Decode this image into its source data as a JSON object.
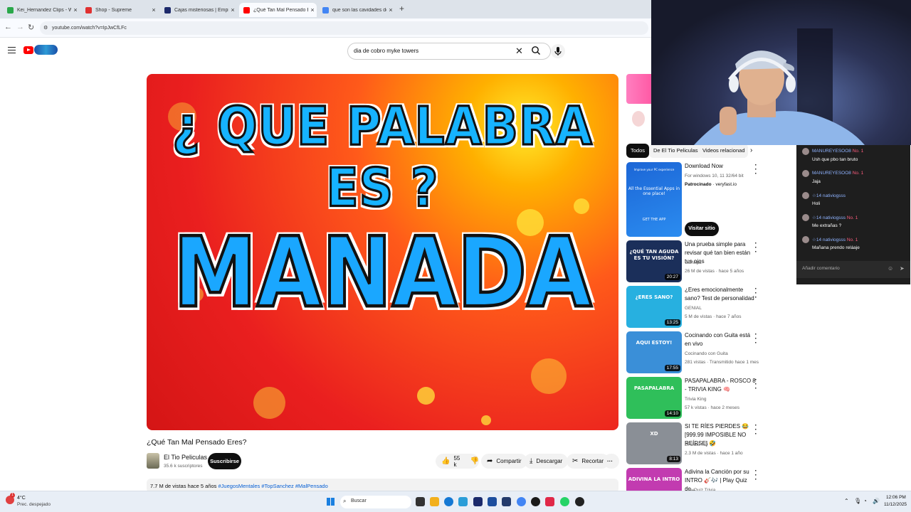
{
  "browser": {
    "tabs": [
      {
        "label": "Kei_Hernandez Clips - Watch L",
        "favicon_color": "#2aa84a",
        "active": false
      },
      {
        "label": "Shop - Supreme",
        "favicon_color": "#e03131",
        "active": false
      },
      {
        "label": "Cajas misteriosas | EmpireDrop",
        "favicon_color": "#1d2a6b",
        "active": false
      },
      {
        "label": "¿Qué Tan Mal Pensado Eres",
        "favicon_color": "#ff0000",
        "active": true
      },
      {
        "label": "que son las cavidades del cora",
        "favicon_color": "#4285f4",
        "active": false
      }
    ],
    "new_tab": "+",
    "url": "youtube.com/watch?v=IpJwCfLFc"
  },
  "youtube": {
    "search_value": "dia de cobro myke towers",
    "video": {
      "overlay_question": "¿ QUE PALABRA ES ?",
      "overlay_word": "MANADA",
      "title": "¿Qué Tan Mal Pensado Eres?",
      "channel": "El Tio Peliculas",
      "subscribers": "35.6 k suscriptores",
      "subscribe_label": "Suscribirse",
      "likes": "55 k",
      "share_label": "Compartir",
      "download_label": "Descargar",
      "clip_label": "Recortar",
      "more": "···",
      "views_date": "7.7 M de vistas  hace 5 años",
      "hashtags": "#JuegosMentales #TopSanchez #MalPensado"
    },
    "chips": [
      "Todos",
      "De El Tio Peliculas",
      "Videos relacionad"
    ],
    "ad": {
      "title": "Download Now",
      "desc": "For windows 10, 11 32/64 bit",
      "sponsor": "Patrocinado",
      "domain": "· veryfast.io",
      "cta": "Visitar sitio",
      "thumb_text": "All the Essential Apps in one place!",
      "thumb_top": "Improve your PC experience",
      "thumb_btn": "GET THE APP"
    },
    "related": [
      {
        "title": "Una prueba simple para revisar qué tan bien están tus ojos",
        "channel": "GENIAL",
        "meta": "26 M de vistas · hace 5 años",
        "duration": "20:27",
        "thumb_text": "¿QUÉ TAN AGUDA ES TU VISIÓN?",
        "bg": "#1b2f5a"
      },
      {
        "title": "¿Eres emocionalmente sano? Test de personalidad",
        "channel": "GENIAL",
        "meta": "5 M de vistas · hace 7 años",
        "duration": "13:25",
        "thumb_text": "¿ERES SANO?",
        "bg": "#27b0e0"
      },
      {
        "title": "Cocinando con Guita está en vivo",
        "channel": "Cocinando con Guita",
        "meta": "281 vistas · Transmitido hace 1 mes",
        "duration": "17:55",
        "thumb_text": "AQUI ESTOY!",
        "bg": "#3a8fd8"
      },
      {
        "title": "PASAPALABRA - ROSCO 8 - TRIVIA KING 🧠",
        "channel": "Trivia King",
        "meta": "57 k vistas · hace 2 meses",
        "duration": "14:10",
        "thumb_text": "PASAPALABRA",
        "bg": "#2fbf5a"
      },
      {
        "title": "SI TE RÍES PIERDES 😂 [999.99 IMPOSIBLE NO REÍRSE] 🤣",
        "channel": "El Gato XD",
        "meta": "2.3 M de vistas · hace 1 año",
        "duration": "8:13",
        "thumb_text": "XD",
        "bg": "#8a8f96"
      },
      {
        "title": "Adivina la Canción por su INTRO 🎸🎶 | Play Quiz de...",
        "channel": "PlayQuiz Trivia",
        "meta": "",
        "duration": "",
        "thumb_text": "ADIVINA LA INTRO",
        "bg": "#c23bb0"
      }
    ]
  },
  "chat": {
    "messages": [
      {
        "user": "MANUREYESOO8",
        "badge": "No. 1",
        "sub": "",
        "text": "Ush que pbo tan bruto"
      },
      {
        "user": "MANUREYESOO8",
        "badge": "No. 1",
        "sub": "",
        "text": "Jaja"
      },
      {
        "user": "nativiogsss",
        "badge": "",
        "sub": "14",
        "text": "Holi"
      },
      {
        "user": "nativiogsss",
        "badge": "No. 1",
        "sub": "14",
        "text": "Me extrañas ?"
      },
      {
        "user": "nativiogsss",
        "badge": "No. 1",
        "sub": "14",
        "text": "Mañana prendo reláaje"
      }
    ],
    "input_placeholder": "Añadir comentario"
  },
  "taskbar": {
    "weather_temp": "4°C",
    "weather_desc": "Prec. despejado",
    "search_placeholder": "Buscar",
    "time": "12:06 PM",
    "date": "11/12/2025",
    "notification_count": "1"
  }
}
